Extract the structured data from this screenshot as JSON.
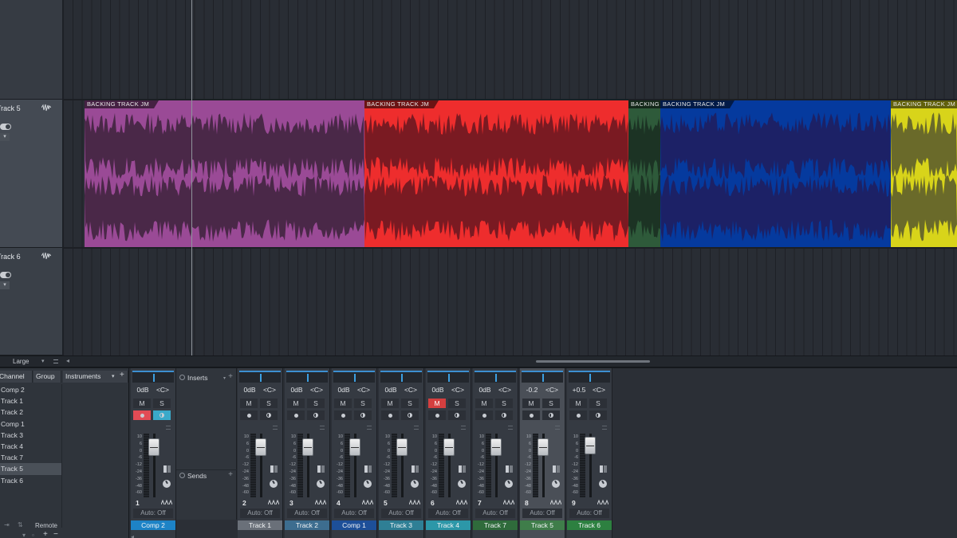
{
  "arrange": {
    "tracks": [
      {
        "name": "Track 5",
        "selected": true
      },
      {
        "name": "Track 6",
        "selected": false
      }
    ],
    "clips": [
      {
        "title": "BACKING TRACK JM",
        "color": "#9a4a96",
        "wave": "#4a2848"
      },
      {
        "title": "BACKING TRACK JM",
        "color": "#ee2d2d",
        "wave": "#7a1a22"
      },
      {
        "title": "BACKING T",
        "color": "#2e5a3a",
        "wave": "#1c3324"
      },
      {
        "title": "BACKING TRACK JM",
        "color": "#053a9e",
        "wave": "#1c2166"
      },
      {
        "title": "BACKING TRACK JM",
        "color": "#d8d41a",
        "wave": "#6a6a2a"
      }
    ],
    "zoom": {
      "label": "Large"
    }
  },
  "browser": {
    "tabs": {
      "channel": "Channel",
      "group": "Group",
      "instruments": "Instruments"
    },
    "channels": [
      "Comp 2",
      "Track 1",
      "Track 2",
      "Comp 1",
      "Track 3",
      "Track 4",
      "Track 7",
      "Track 5",
      "Track 6"
    ],
    "selected_channel": "Track 5",
    "remote_label": "Remote"
  },
  "comp2_panel": {
    "inserts_label": "Inserts",
    "sends_label": "Sends"
  },
  "strips": [
    {
      "num": "1",
      "name": "Comp 2",
      "vol": "0dB",
      "pan": "<C>",
      "auto": "Auto: Off",
      "name_color": "#1d83c6",
      "record": true,
      "monitor": true,
      "muted": false,
      "selected": false
    },
    {
      "num": "2",
      "name": "Track 1",
      "vol": "0dB",
      "pan": "<C>",
      "auto": "Auto: Off",
      "name_color": "#6a7079",
      "record": false,
      "monitor": false,
      "muted": false,
      "selected": false
    },
    {
      "num": "3",
      "name": "Track 2",
      "vol": "0dB",
      "pan": "<C>",
      "auto": "Auto: Off",
      "name_color": "#3d6d8f",
      "record": false,
      "monitor": false,
      "muted": false,
      "selected": false
    },
    {
      "num": "4",
      "name": "Comp 1",
      "vol": "0dB",
      "pan": "<C>",
      "auto": "Auto: Off",
      "name_color": "#1d4f99",
      "record": false,
      "monitor": false,
      "muted": false,
      "selected": false
    },
    {
      "num": "5",
      "name": "Track 3",
      "vol": "0dB",
      "pan": "<C>",
      "auto": "Auto: Off",
      "name_color": "#2f7f95",
      "record": false,
      "monitor": false,
      "muted": false,
      "selected": false
    },
    {
      "num": "6",
      "name": "Track 4",
      "vol": "0dB",
      "pan": "<C>",
      "auto": "Auto: Off",
      "name_color": "#2c97a8",
      "record": false,
      "monitor": false,
      "muted": true,
      "selected": false
    },
    {
      "num": "7",
      "name": "Track 7",
      "vol": "0dB",
      "pan": "<C>",
      "auto": "Auto: Off",
      "name_color": "#2f6b3b",
      "record": false,
      "monitor": false,
      "muted": false,
      "selected": false
    },
    {
      "num": "8",
      "name": "Track 5",
      "vol": "-0.2",
      "pan": "<C>",
      "auto": "Auto: Off",
      "name_color": "#3f7d4a",
      "record": false,
      "monitor": false,
      "muted": false,
      "selected": true
    },
    {
      "num": "9",
      "name": "Track 6",
      "vol": "+0.5",
      "pan": "<C>",
      "auto": "Auto: Off",
      "name_color": "#2d8040",
      "record": false,
      "monitor": false,
      "muted": false,
      "selected": false
    }
  ],
  "meter_scale": [
    "10",
    "6",
    "0",
    "-6",
    "-12",
    "-24",
    "-36",
    "-48",
    "-60"
  ]
}
